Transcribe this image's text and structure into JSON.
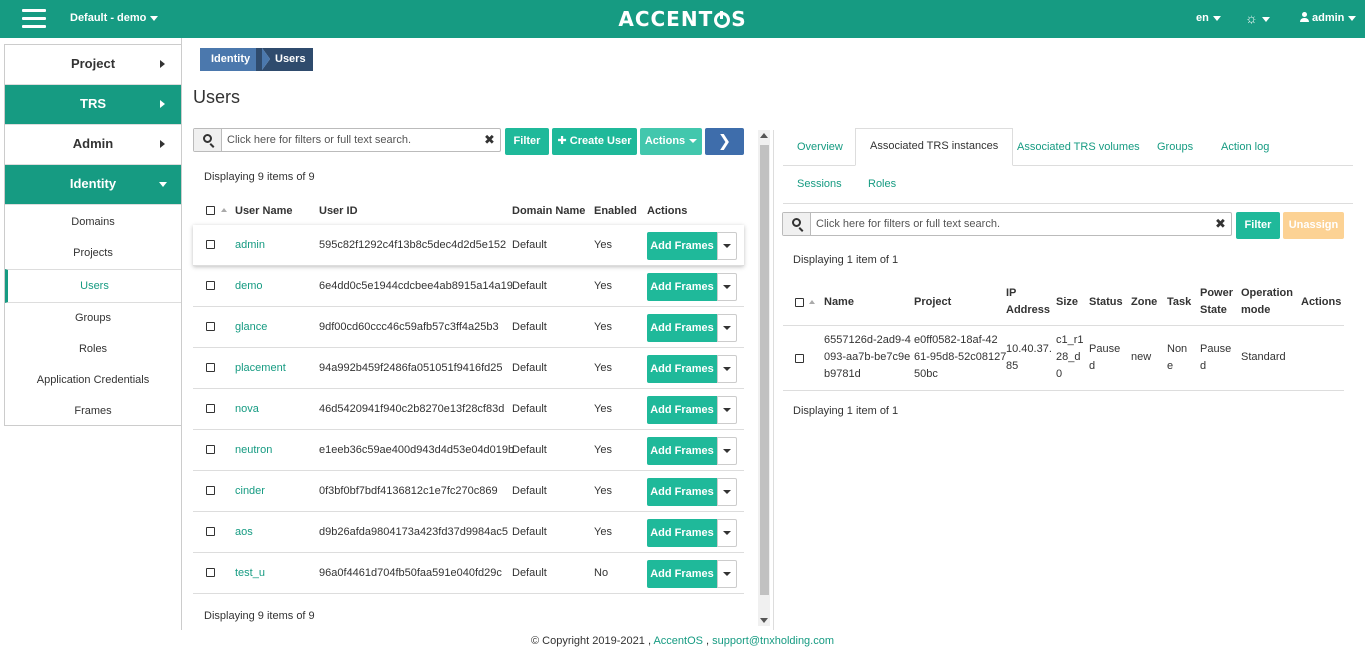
{
  "header": {
    "project_switch": "Default - demo",
    "brand_pre": "ACCENT",
    "brand_post": "S",
    "language": "en",
    "user": "admin"
  },
  "sidebar": {
    "groups": [
      {
        "label": "Project"
      },
      {
        "label": "TRS"
      },
      {
        "label": "Admin"
      },
      {
        "label": "Identity"
      }
    ],
    "items": [
      {
        "label": "Domains"
      },
      {
        "label": "Projects"
      },
      {
        "label": "Users"
      },
      {
        "label": "Groups"
      },
      {
        "label": "Roles"
      },
      {
        "label": "Application Credentials"
      },
      {
        "label": "Frames"
      }
    ]
  },
  "breadcrumb": {
    "parent": "Identity",
    "current": "Users"
  },
  "page_title": "Users",
  "users_panel": {
    "search_placeholder": "Click here for filters or full text search.",
    "filter_label": "Filter",
    "create_label": "Create User",
    "actions_label": "Actions",
    "displaying_top": "Displaying 9 items of 9",
    "displaying_bottom": "Displaying 9 items of 9",
    "columns": [
      "User Name",
      "User ID",
      "Domain Name",
      "Enabled",
      "Actions"
    ],
    "row_action_label": "Add Frames",
    "rows": [
      {
        "name": "admin",
        "id": "595c82f1292c4f13b8c5dec4d2d5e152",
        "domain": "Default",
        "enabled": "Yes"
      },
      {
        "name": "demo",
        "id": "6e4dd0c5e1944cdcbee4ab8915a14a19",
        "domain": "Default",
        "enabled": "Yes"
      },
      {
        "name": "glance",
        "id": "9df00cd60ccc46c59afb57c3ff4a25b3",
        "domain": "Default",
        "enabled": "Yes"
      },
      {
        "name": "placement",
        "id": "94a992b459f2486fa051051f9416fd25",
        "domain": "Default",
        "enabled": "Yes"
      },
      {
        "name": "nova",
        "id": "46d5420941f940c2b8270e13f28cf83d",
        "domain": "Default",
        "enabled": "Yes"
      },
      {
        "name": "neutron",
        "id": "e1eeb36c59ae400d943d4d53e04d019b",
        "domain": "Default",
        "enabled": "Yes"
      },
      {
        "name": "cinder",
        "id": "0f3bf0bf7bdf4136812c1e7fc270c869",
        "domain": "Default",
        "enabled": "Yes"
      },
      {
        "name": "aos",
        "id": "d9b26afda9804173a423fd37d9984ac5",
        "domain": "Default",
        "enabled": "Yes"
      },
      {
        "name": "test_u",
        "id": "96a0f4461d704fb50faa591e040fd29c",
        "domain": "Default",
        "enabled": "No"
      }
    ]
  },
  "detail_panel": {
    "tabs": [
      "Overview",
      "Associated TRS instances",
      "Associated TRS volumes",
      "Groups",
      "Action log",
      "Sessions",
      "Roles"
    ],
    "search_placeholder": "Click here for filters or full text search.",
    "filter_label": "Filter",
    "unassign_label": "Unassign",
    "displaying_top": "Displaying 1 item of 1",
    "displaying_bottom": "Displaying 1 item of 1",
    "columns": {
      "name": "Name",
      "project": "Project",
      "ip_1": "IP",
      "ip_2": "Address",
      "size": "Size",
      "status": "Status",
      "zone": "Zone",
      "task": "Task",
      "power_1": "Power",
      "power_2": "State",
      "op_1": "Operation",
      "op_2": "mode",
      "actions": "Actions"
    },
    "row": {
      "name_lines": [
        "6557126d-2ad9-4",
        "093-aa7b-be7c9e",
        "b9781d"
      ],
      "project_lines": [
        "e0ff0582-18af-42",
        "61-95d8-52c08127",
        "50bc"
      ],
      "ip_lines": [
        "10.40.37.",
        "85"
      ],
      "size_lines": [
        "c1_r1",
        "28_d",
        "0"
      ],
      "status_lines": [
        "Pause",
        "d"
      ],
      "zone": "new",
      "task_lines": [
        "Non",
        "e"
      ],
      "power_lines": [
        "Pause",
        "d"
      ],
      "operation_mode": "Standard"
    }
  },
  "footer": {
    "copyright": "© Copyright 2019-2021 ,",
    "brand_link": "AccentOS",
    "sep": ",",
    "email": "support@tnxholding.com"
  }
}
